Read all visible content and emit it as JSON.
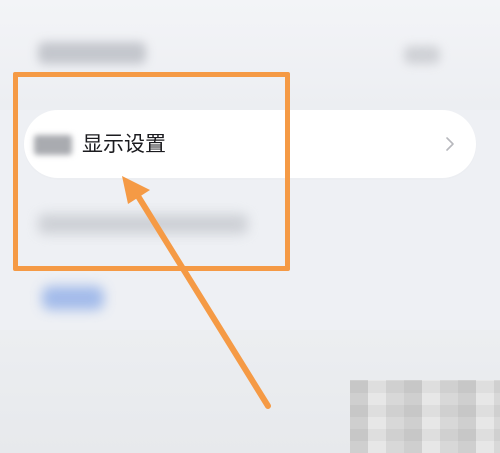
{
  "settings_row": {
    "label": "显示设置",
    "icon": "chevron-right-icon"
  },
  "annotation": {
    "color": "#f59a45",
    "arrow_icon": "arrow-up-left-icon",
    "box_icon": "highlight-rectangle"
  }
}
